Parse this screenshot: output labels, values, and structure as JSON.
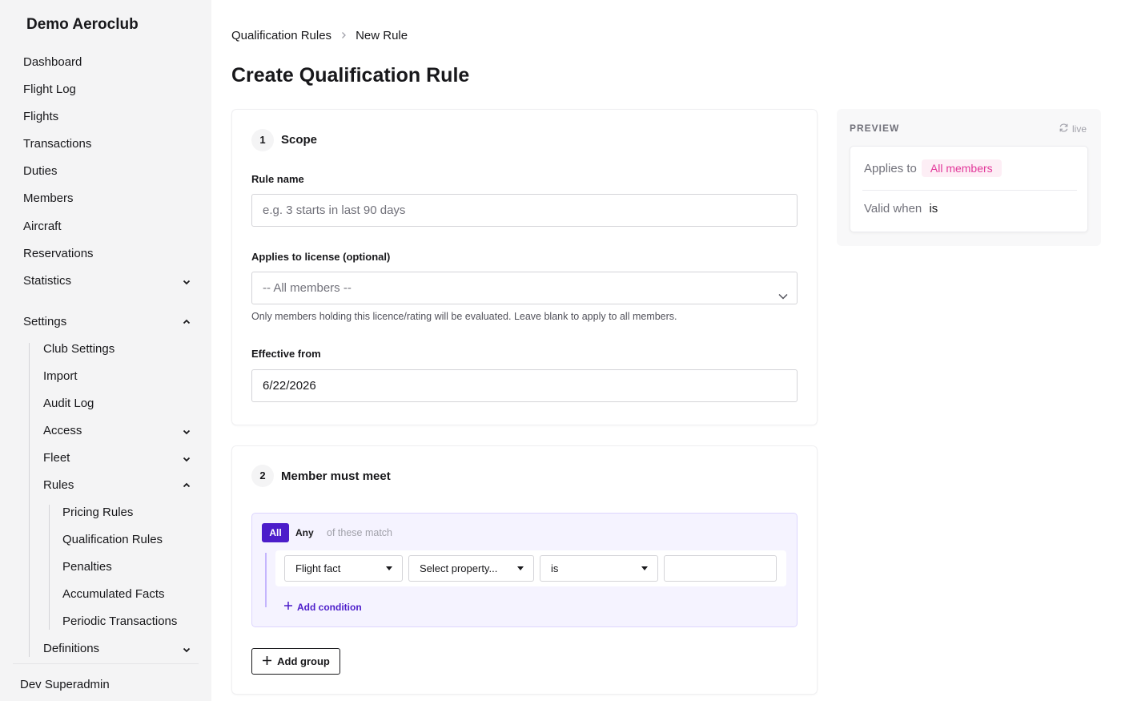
{
  "sidebar": {
    "brand": "Demo Aeroclub",
    "items": [
      {
        "label": "Dashboard"
      },
      {
        "label": "Flight Log"
      },
      {
        "label": "Flights"
      },
      {
        "label": "Transactions"
      },
      {
        "label": "Duties"
      },
      {
        "label": "Members"
      },
      {
        "label": "Aircraft"
      },
      {
        "label": "Reservations"
      },
      {
        "label": "Statistics",
        "expanded": false
      },
      {
        "label": "Settings",
        "expanded": true
      }
    ],
    "settings_children": [
      {
        "label": "Club Settings"
      },
      {
        "label": "Import"
      },
      {
        "label": "Audit Log"
      },
      {
        "label": "Access",
        "expanded": false
      },
      {
        "label": "Fleet",
        "expanded": false
      },
      {
        "label": "Rules",
        "expanded": true
      },
      {
        "label": "Definitions",
        "expanded": false
      }
    ],
    "rules_children": [
      {
        "label": "Pricing Rules"
      },
      {
        "label": "Qualification Rules"
      },
      {
        "label": "Penalties"
      },
      {
        "label": "Accumulated Facts"
      },
      {
        "label": "Periodic Transactions"
      }
    ],
    "user": "Dev Superadmin"
  },
  "breadcrumb": {
    "parent": "Qualification Rules",
    "current": "New Rule"
  },
  "page_title": "Create Qualification Rule",
  "scope": {
    "step": "1",
    "title": "Scope",
    "rule_name_label": "Rule name",
    "rule_name_placeholder": "e.g. 3 starts in last 90 days",
    "license_label": "Applies to license (optional)",
    "license_value": "-- All members --",
    "license_help": "Only members holding this licence/rating will be evaluated. Leave blank to apply to all members.",
    "effective_label": "Effective from",
    "effective_value": "6/22/2026"
  },
  "conditions": {
    "step": "2",
    "title": "Member must meet",
    "match_all": "All",
    "match_any": "Any",
    "match_note": "of these match",
    "selected_match": "All",
    "condition": {
      "fact_type": "Flight fact",
      "property": "Select property...",
      "operator": "is",
      "value": ""
    },
    "add_condition": "Add condition",
    "add_group": "Add group"
  },
  "preview": {
    "title": "PREVIEW",
    "live": "live",
    "applies_to_label": "Applies to",
    "applies_to_value": "All members",
    "valid_when_label": "Valid when",
    "valid_when_value": "is"
  },
  "colors": {
    "accent": "#4c1dca",
    "pill_bg": "#fdeef5",
    "pill_text": "#e2389a",
    "group_bg": "#f5f3ff"
  }
}
